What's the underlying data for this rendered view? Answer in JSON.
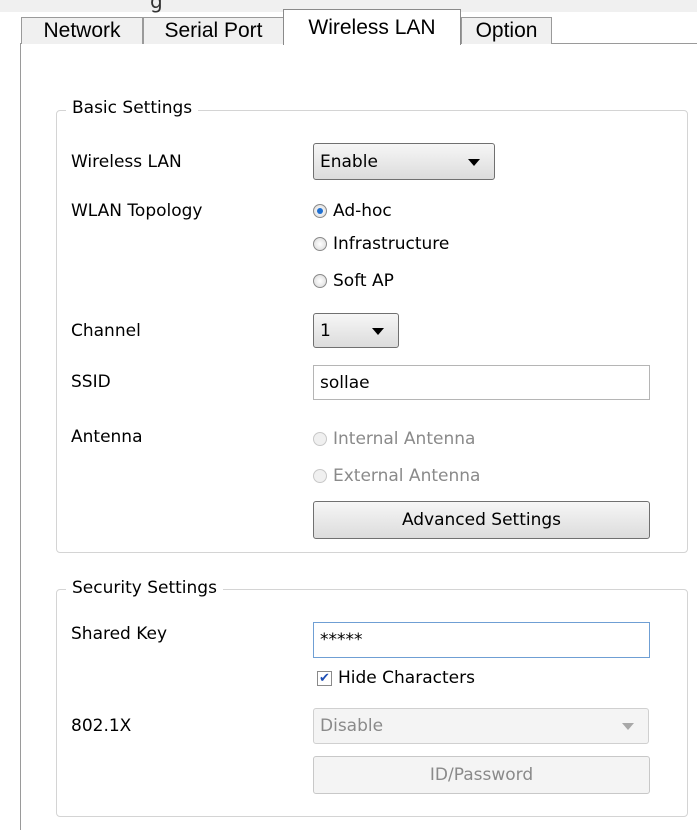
{
  "tabs": [
    {
      "label": "Network"
    },
    {
      "label": "Serial Port"
    },
    {
      "label": "Wireless LAN"
    },
    {
      "label": "Option"
    }
  ],
  "clipped_caption": "g",
  "basic": {
    "legend": "Basic Settings",
    "wlan_label": "Wireless LAN",
    "wlan_value": "Enable",
    "topology_label": "WLAN Topology",
    "topology_options": [
      "Ad-hoc",
      "Infrastructure",
      "Soft AP"
    ],
    "topology_selected": "Ad-hoc",
    "channel_label": "Channel",
    "channel_value": "1",
    "ssid_label": "SSID",
    "ssid_value": "sollae",
    "antenna_label": "Antenna",
    "antenna_options": [
      "Internal Antenna",
      "External Antenna"
    ],
    "advanced_button": "Advanced Settings"
  },
  "security": {
    "legend": "Security Settings",
    "key_label": "Shared Key",
    "key_value": "*****",
    "hide_label": "Hide Characters",
    "hide_checked": true,
    "x8021_label": "802.1X",
    "x8021_value": "Disable",
    "idpw_button": "ID/Password"
  },
  "colors": {
    "accent": "#1f6fd1",
    "disabled_text": "#8a8a8a",
    "group_border": "#d4d4d4"
  },
  "icons": {
    "dropdown": "chevron-down-icon",
    "checkbox": "check-icon"
  }
}
